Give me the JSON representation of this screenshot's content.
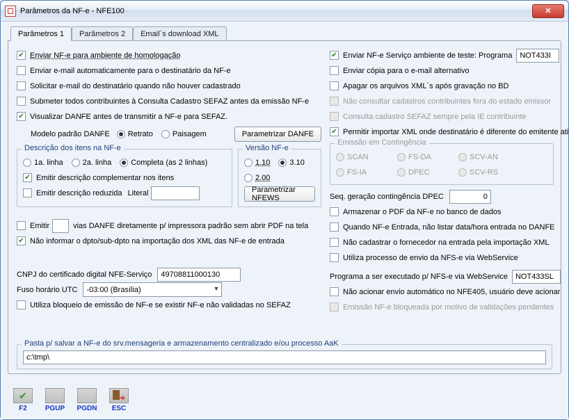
{
  "window": {
    "title": "Parâmetros da NF-e - NFE100"
  },
  "tabs": {
    "t1": "Parâmetros 1",
    "t2": "Parâmetros 2",
    "t3": "Email´s download XML"
  },
  "left": {
    "c1": "Enviar NF-e para ambiente de homologação",
    "c2": "Enviar e-mail automaticamente para o destinatário da NF-e",
    "c3": "Solicitar e-mail do destinatário quando não houver cadastrado",
    "c4": "Submeter todos contribuintes à Consulta Cadastro SEFAZ antes da emissão NF-e",
    "c5": "Visualizar DANFE antes de transmitir a NF-e para SEFAZ.",
    "modelo_lbl": "Modelo padrão DANFE",
    "r_retrato": "Retrato",
    "r_paisagem": "Paisagem",
    "btn_param_danfe": "Parametrizar DANFE",
    "grp_descricao": "Descrição dos itens na NF-e",
    "r_1linha": "1a. linha",
    "r_2linha": "2a. linha",
    "r_completa": "Completa (as 2 linhas)",
    "c_emitir_compl": "Emitir descrição complementar nos itens",
    "c_emitir_red": "Emitir descrição reduzida",
    "literal_lbl": "Literal",
    "literal_val": "",
    "grp_versao": "Versão NF-e",
    "r_110": "1.10",
    "r_310": "3.10",
    "r_200": "2.00",
    "btn_param_nfews": "Parametrizar NFEWS",
    "c_emitir_vias": "Emitir",
    "vias_val": "",
    "vias_rest": "vias DANFE diretamente p/ impressora padrão sem abrir PDF na tela",
    "c_nao_informar": "Não informar o dpto/sub-dpto na importação dos XML das NF-e de entrada",
    "cnpj_lbl": "CNPJ do certificado digital NFE-Serviço",
    "cnpj_val": "49708811000130",
    "fuso_lbl": "Fuso horário UTC",
    "fuso_val": "-03:00 (Brasília)",
    "c_bloqueio": "Utiliza bloqueio de emissão de NF-e se existir NF-e não validadas no SEFAZ"
  },
  "right": {
    "c_teste": "Enviar NF-e Serviço ambiente de teste: Programa",
    "teste_prog": "NOT433I",
    "c_copia": "Enviar cópia para o e-mail alternativo",
    "c_apagar": "Apagar os arquivos XML´s após gravação no BD",
    "c_nao_consultar": "Não consultar cadastros contribuintes fora do estado emissor",
    "c_consulta_ie": "Consulta cadastro SEFAZ sempre pela IE contribuinte",
    "c_permitir_importar": "Permitir importar XML onde destinatário é diferente do emitente ativo",
    "grp_conting": "Emissão em Contingência",
    "r_scan": "SCAN",
    "r_fsda": "FS-DA",
    "r_scvan": "SCV-AN",
    "r_fsia": "FS-IA",
    "r_dpec": "DPEC",
    "r_scvrs": "SCV-RS",
    "seq_lbl": "Seq. geração contingência DPEC",
    "seq_val": "0",
    "c_armazenar_pdf": "Armazenar o PDF da NF-e no banco de dados",
    "c_entrada_data": "Quando NF-e Entrada, não listar data/hora entrada no DANFE",
    "c_nao_cad_forn": "Não cadastrar o fornecedor na entrada pela importação XML",
    "c_webservice": "Utiliza processo de envio da NFS-e via WebService",
    "prog_lbl": "Programa a ser executado p/ NFS-e via WebService",
    "prog_val": "NOT433SL",
    "c_nao_acionar": "Não acionar envio automático no NFE405, usuário deve acionar",
    "c_emissao_bloq": "Emissão NF-e bloqueada por motivo de validações pendentes"
  },
  "pasta": {
    "legend": "Pasta p/ salvar a NF-e do srv.mensageria e armazenamento centralizado e/ou processo AaK",
    "value": "c:\\tmp\\"
  },
  "footer": {
    "f2": "F2",
    "pgup": "PGUP",
    "pgdn": "PGDN",
    "esc": "ESC"
  }
}
